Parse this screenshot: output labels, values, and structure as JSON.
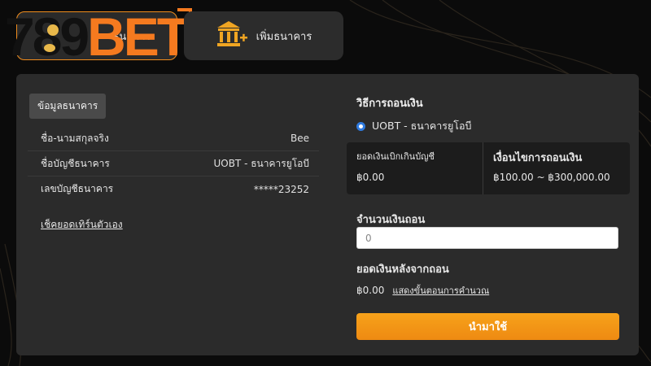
{
  "tabs": {
    "active_label": "ข้อมูลบัญชีธนาคาร",
    "active_visible_label": "ธนาคาร",
    "bank_label": "เพิ่มธนาคาร"
  },
  "logo": {
    "number_text": "789",
    "brand_text": "BET"
  },
  "bank_info": {
    "section_title": "ข้อมูลธนาคาร",
    "rows": [
      {
        "label": "ชื่อ-นามสกุลจริง",
        "value": "Bee"
      },
      {
        "label": "ชื่อบัญชีธนาคาร",
        "value": "UOBT - ธนาคารยูโอบี"
      },
      {
        "label": "เลขบัญชีธนาคาร",
        "value": "*****23252"
      }
    ],
    "self_check_link": "เช็คยอดเทิร์นตัวเอง"
  },
  "withdraw": {
    "method_title": "วิธีการถอนเงิน",
    "method_option": "UOBT - ธนาคารยูโอบี",
    "summary": {
      "balance_label": "ยอดเงินเบิกเกินบัญชี",
      "balance_value": "฿0.00",
      "condition_label": "เงื่อนไขการถอนเงิน",
      "condition_value": "฿100.00 ~ ฿300,000.00"
    },
    "amount_label": "จำนวนเงินถอน",
    "amount_placeholder": "0",
    "after_label": "ยอดเงินหลังจากถอน",
    "after_value": "฿0.00",
    "calc_link": "แสดงขั้นตอนการคำนวณ",
    "submit_label": "นำมาใช้"
  },
  "colors": {
    "accent": "#f08c1c",
    "brand": "#f57a1f",
    "panel": "#2b2b2b",
    "radio": "#2f7be0"
  },
  "icons": [
    "bank-plus-icon",
    "radio-selected-icon"
  ]
}
